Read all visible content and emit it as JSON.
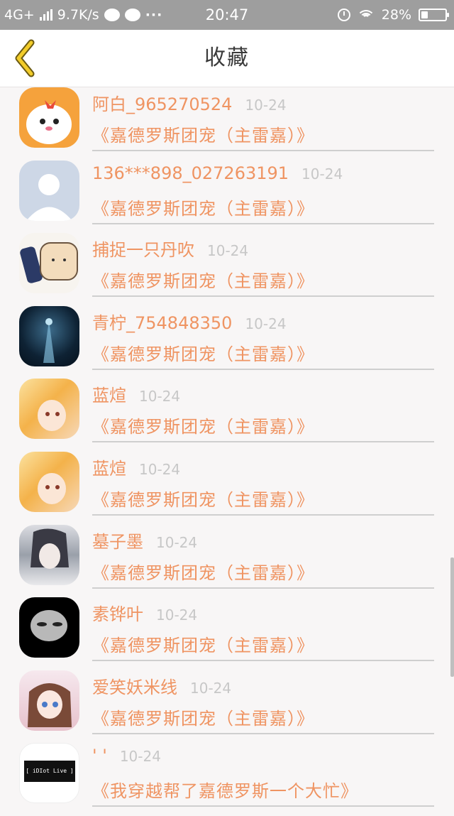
{
  "status_bar": {
    "network": "4G+",
    "speed": "9.7K/s",
    "time": "20:47",
    "battery": "28%",
    "battery_level": 0.28
  },
  "header": {
    "title": "收藏",
    "back_icon": "chevron-left-icon"
  },
  "accent_color": "#ef9462",
  "items": [
    {
      "name": "阿白_965270524",
      "date": "10-24",
      "title": "《嘉德罗斯团宠（主雷嘉）》"
    },
    {
      "name": "136***898_027263191",
      "date": "10-24",
      "title": "《嘉德罗斯团宠（主雷嘉）》"
    },
    {
      "name": "捕捉一只丹吹",
      "date": "10-24",
      "title": "《嘉德罗斯团宠（主雷嘉）》"
    },
    {
      "name": "青柠_754848350",
      "date": "10-24",
      "title": "《嘉德罗斯团宠（主雷嘉）》"
    },
    {
      "name": "蓝煊",
      "date": "10-24",
      "title": "《嘉德罗斯团宠（主雷嘉）》"
    },
    {
      "name": "蓝煊",
      "date": "10-24",
      "title": "《嘉德罗斯团宠（主雷嘉）》"
    },
    {
      "name": "墓子墨",
      "date": "10-24",
      "title": "《嘉德罗斯团宠（主雷嘉）》"
    },
    {
      "name": "素铧叶",
      "date": "10-24",
      "title": "《嘉德罗斯团宠（主雷嘉）》"
    },
    {
      "name": "爱笑妖米线",
      "date": "10-24",
      "title": "《嘉德罗斯团宠（主雷嘉）》"
    },
    {
      "name": "' '",
      "date": "10-24",
      "title": "《我穿越帮了嘉德罗斯一个大忙》",
      "avatar_text": "[ iDIot Live ]"
    }
  ]
}
